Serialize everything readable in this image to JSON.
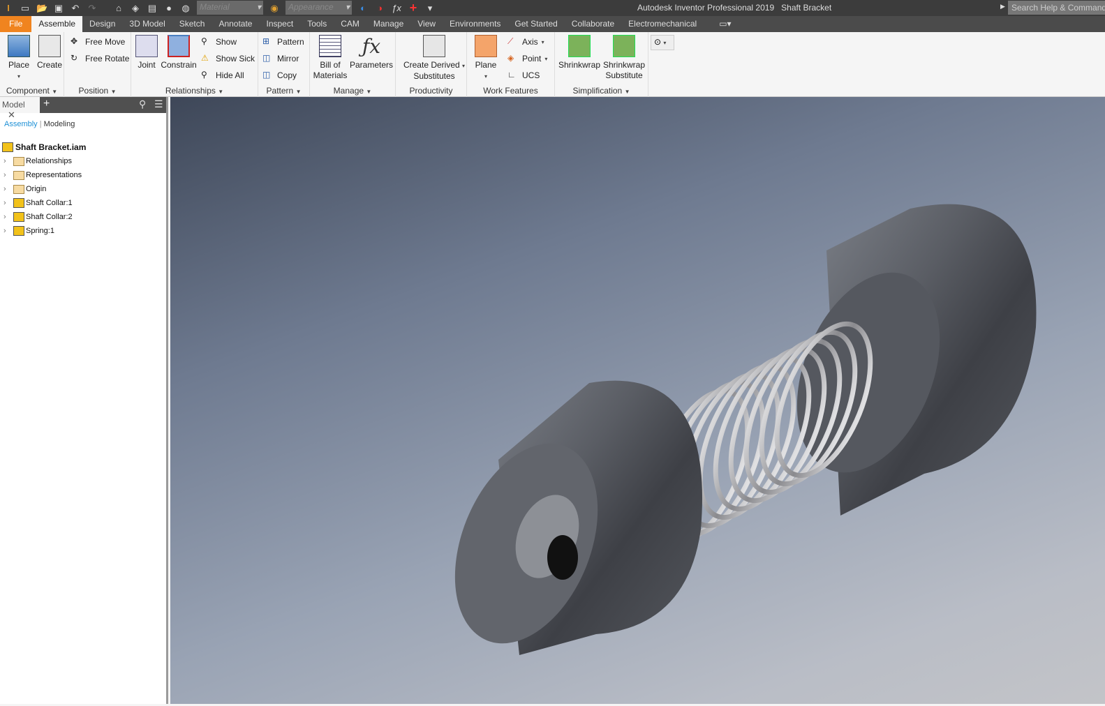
{
  "titlebar": {
    "material_placeholder": "Material",
    "appearance_placeholder": "Appearance",
    "app_title": "Autodesk Inventor Professional 2019",
    "doc_title": "Shaft Bracket",
    "search_placeholder": "Search Help & Commands..."
  },
  "tabs": [
    "File",
    "Assemble",
    "Design",
    "3D Model",
    "Sketch",
    "Annotate",
    "Inspect",
    "Tools",
    "CAM",
    "Manage",
    "View",
    "Environments",
    "Get Started",
    "Collaborate",
    "Electromechanical"
  ],
  "ribbon": {
    "component": {
      "title": "Component",
      "place": "Place",
      "create": "Create"
    },
    "position": {
      "title": "Position",
      "free_move": "Free Move",
      "free_rotate": "Free Rotate"
    },
    "relationships": {
      "title": "Relationships",
      "joint": "Joint",
      "constrain": "Constrain",
      "show": "Show",
      "show_sick": "Show Sick",
      "hide_all": "Hide All"
    },
    "pattern": {
      "title": "Pattern",
      "pattern": "Pattern",
      "mirror": "Mirror",
      "copy": "Copy"
    },
    "manage": {
      "title": "Manage",
      "bom_1": "Bill of",
      "bom_2": "Materials",
      "parameters": "Parameters"
    },
    "productivity": {
      "title": "Productivity",
      "derived_1": "Create Derived",
      "derived_2": "Substitutes"
    },
    "work_features": {
      "title": "Work Features",
      "plane": "Plane",
      "axis": "Axis",
      "point": "Point",
      "ucs": "UCS"
    },
    "simplification": {
      "title": "Simplification",
      "shrinkwrap": "Shrinkwrap",
      "sw_sub_1": "Shrinkwrap",
      "sw_sub_2": "Substitute"
    }
  },
  "browser": {
    "tab": "Model",
    "mode_assembly": "Assembly",
    "mode_modeling": "Modeling",
    "root": "Shaft Bracket.iam",
    "items": [
      "Relationships",
      "Representations",
      "Origin",
      "Shaft Collar:1",
      "Shaft Collar:2",
      "Spring:1"
    ]
  },
  "colors": {
    "file_tab": "#f0841f",
    "accent_link": "#1e90d6"
  }
}
